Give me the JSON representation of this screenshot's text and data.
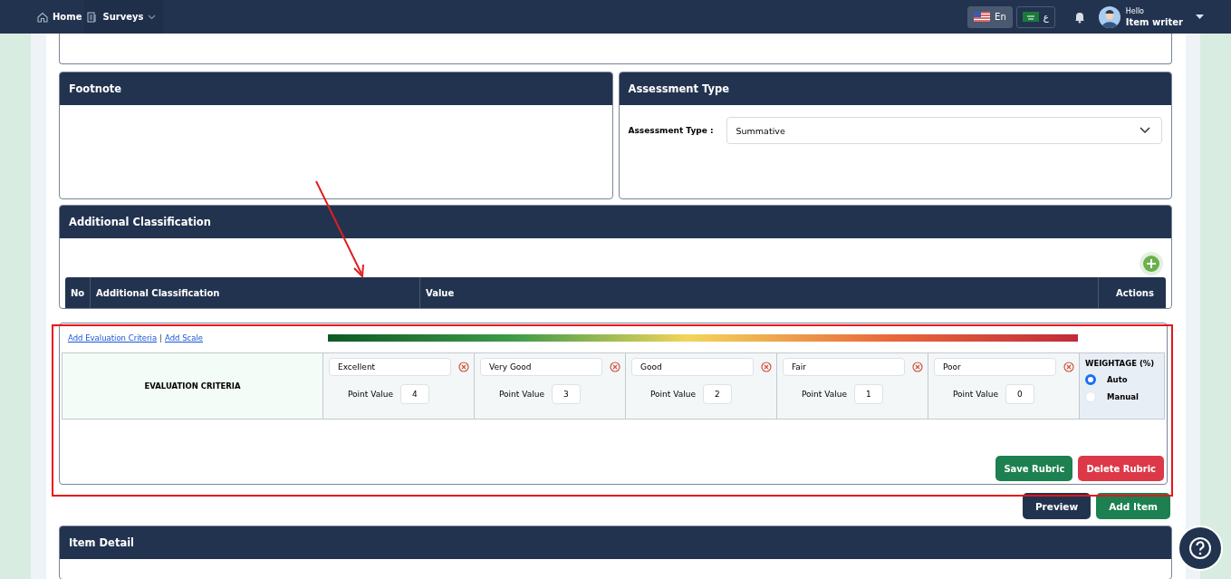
{
  "nav": {
    "items": [
      {
        "label": "Home",
        "kind": "home"
      },
      {
        "label": "Surveys",
        "kind": "surveys"
      }
    ],
    "languages": [
      {
        "label": "En",
        "kind": "us",
        "selected": true
      },
      {
        "label": "ع",
        "kind": "sa",
        "selected": false
      }
    ],
    "user": {
      "greeting": "Hello",
      "name": "Item writer"
    }
  },
  "footnote": {
    "title": "Footnote"
  },
  "assessment": {
    "title": "Assessment Type",
    "label": "Assessment Type :",
    "value": "Summative"
  },
  "classification": {
    "title": "Additional Classification",
    "columns": [
      "No",
      "Additional Classification",
      "Value",
      "Actions"
    ]
  },
  "rubric": {
    "links": [
      "Add Evaluation Criteria",
      "Add Scale"
    ],
    "separator": "|",
    "criteria_label": "EVALUATION CRITERIA",
    "scales": [
      {
        "name": "Excellent",
        "point_label": "Point Value",
        "points": "4"
      },
      {
        "name": "Very Good",
        "point_label": "Point Value",
        "points": "3"
      },
      {
        "name": "Good",
        "point_label": "Point Value",
        "points": "2"
      },
      {
        "name": "Fair",
        "point_label": "Point Value",
        "points": "1"
      },
      {
        "name": "Poor",
        "point_label": "Point Value",
        "points": "0"
      }
    ],
    "weightage": {
      "title": "WEIGHTAGE (%)",
      "options": [
        {
          "label": "Auto",
          "selected": true
        },
        {
          "label": "Manual",
          "selected": false
        }
      ]
    },
    "buttons": [
      {
        "label": "Save Rubric",
        "kind": "save"
      },
      {
        "label": "Delete Rubric",
        "kind": "delete"
      }
    ]
  },
  "actions": [
    {
      "label": "Preview",
      "kind": "primary"
    },
    {
      "label": "Add Item",
      "kind": "success"
    }
  ],
  "item_detail": {
    "title": "Item Detail"
  }
}
